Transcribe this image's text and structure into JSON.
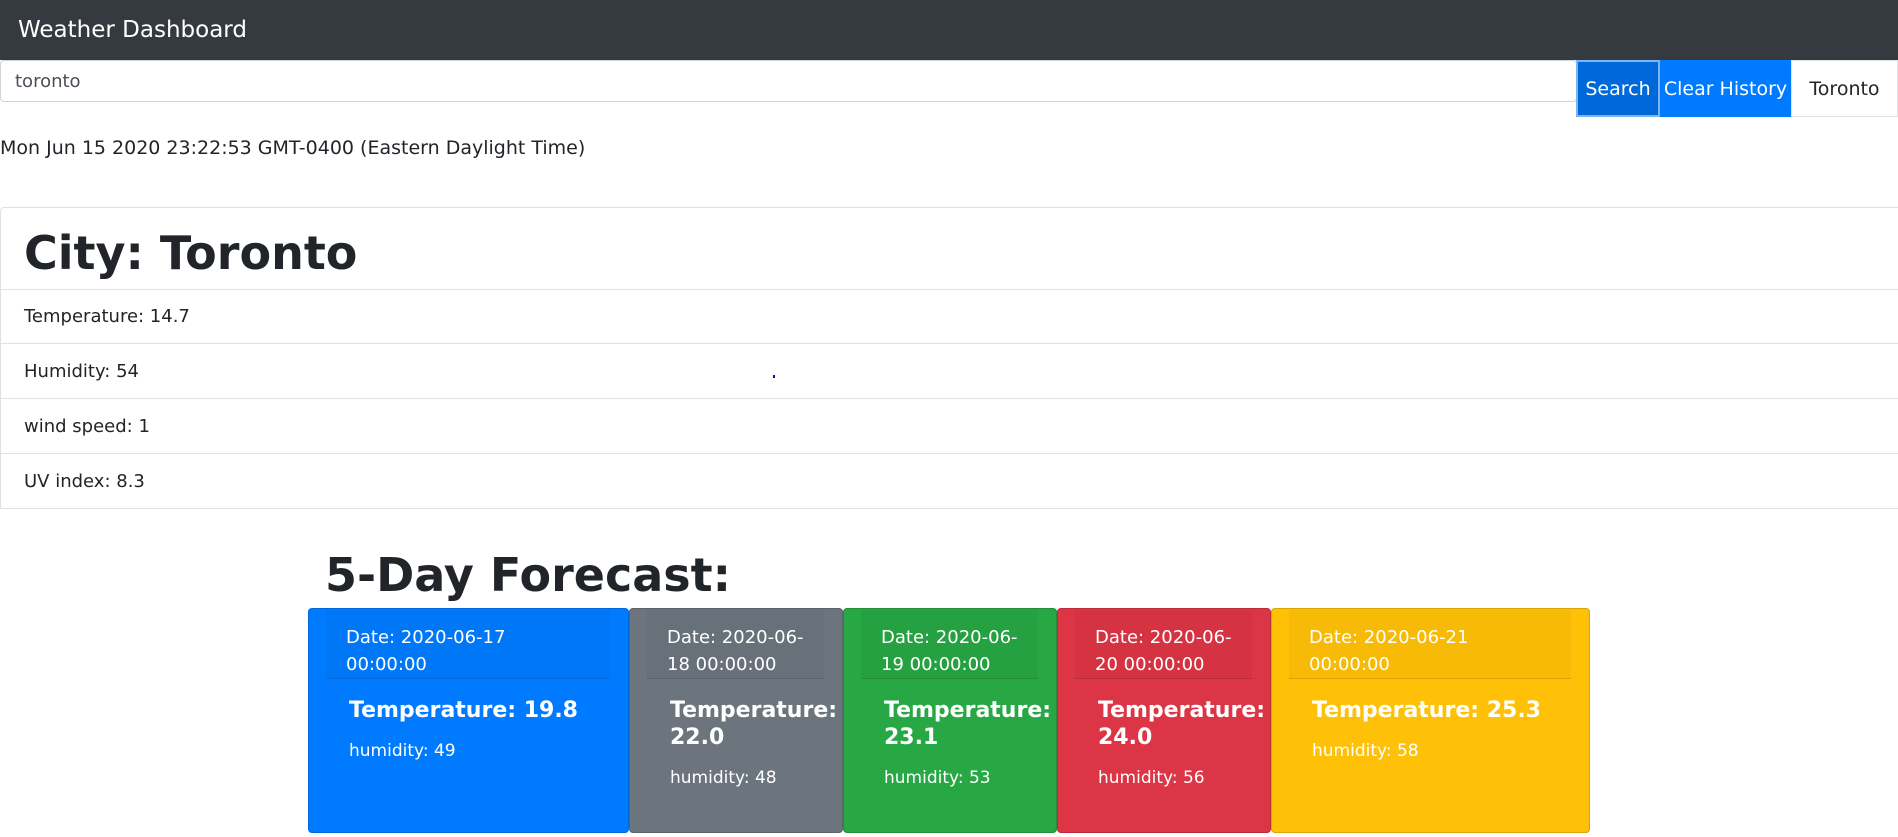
{
  "navbar": {
    "title": "Weather Dashboard"
  },
  "search": {
    "value": "toronto",
    "button_label": "Search",
    "clear_label": "Clear History"
  },
  "history": [
    "Toronto"
  ],
  "current_date": "Mon Jun 15 2020 23:22:53 GMT-0400 (Eastern Daylight Time)",
  "current": {
    "city": "City: Toronto",
    "temperature": "Temperature: 14.7",
    "humidity": "Humidity: 54",
    "wind": "wind speed: 1",
    "uv": "UV index: 8.3"
  },
  "forecast": {
    "title": "5-Day Forecast:",
    "days": [
      {
        "date": "Date: 2020-06-17 00:00:00",
        "temp": "Temperature: 19.8",
        "humidity": "humidity: 49",
        "color": "#007bff"
      },
      {
        "date": "Date: 2020-06-18 00:00:00",
        "temp": "Temperature: 22.0",
        "humidity": "humidity: 48",
        "color": "#6c757d"
      },
      {
        "date": "Date: 2020-06-19 00:00:00",
        "temp": "Temperature: 23.1",
        "humidity": "humidity: 53",
        "color": "#28a745"
      },
      {
        "date": "Date: 2020-06-20 00:00:00",
        "temp": "Temperature: 24.0",
        "humidity": "humidity: 56",
        "color": "#dc3545"
      },
      {
        "date": "Date: 2020-06-21 00:00:00",
        "temp": "Temperature: 25.3",
        "humidity": "humidity: 58",
        "color": "#ffc107"
      }
    ]
  }
}
